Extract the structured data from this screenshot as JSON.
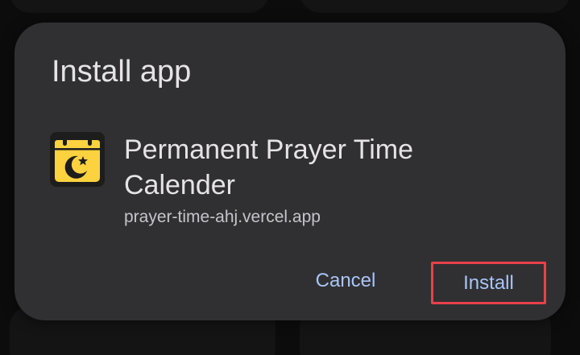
{
  "dialog": {
    "title": "Install app",
    "app_name": "Permanent Prayer Time Calender",
    "app_url": "prayer-time-ahj.vercel.app",
    "app_icon": "calendar-moon-icon",
    "cancel_label": "Cancel",
    "install_label": "Install"
  },
  "colors": {
    "dialog_bg": "#303033",
    "button_text": "#a9c5f6",
    "highlight": "#e8414b",
    "icon_yellow": "#fdd23f"
  }
}
